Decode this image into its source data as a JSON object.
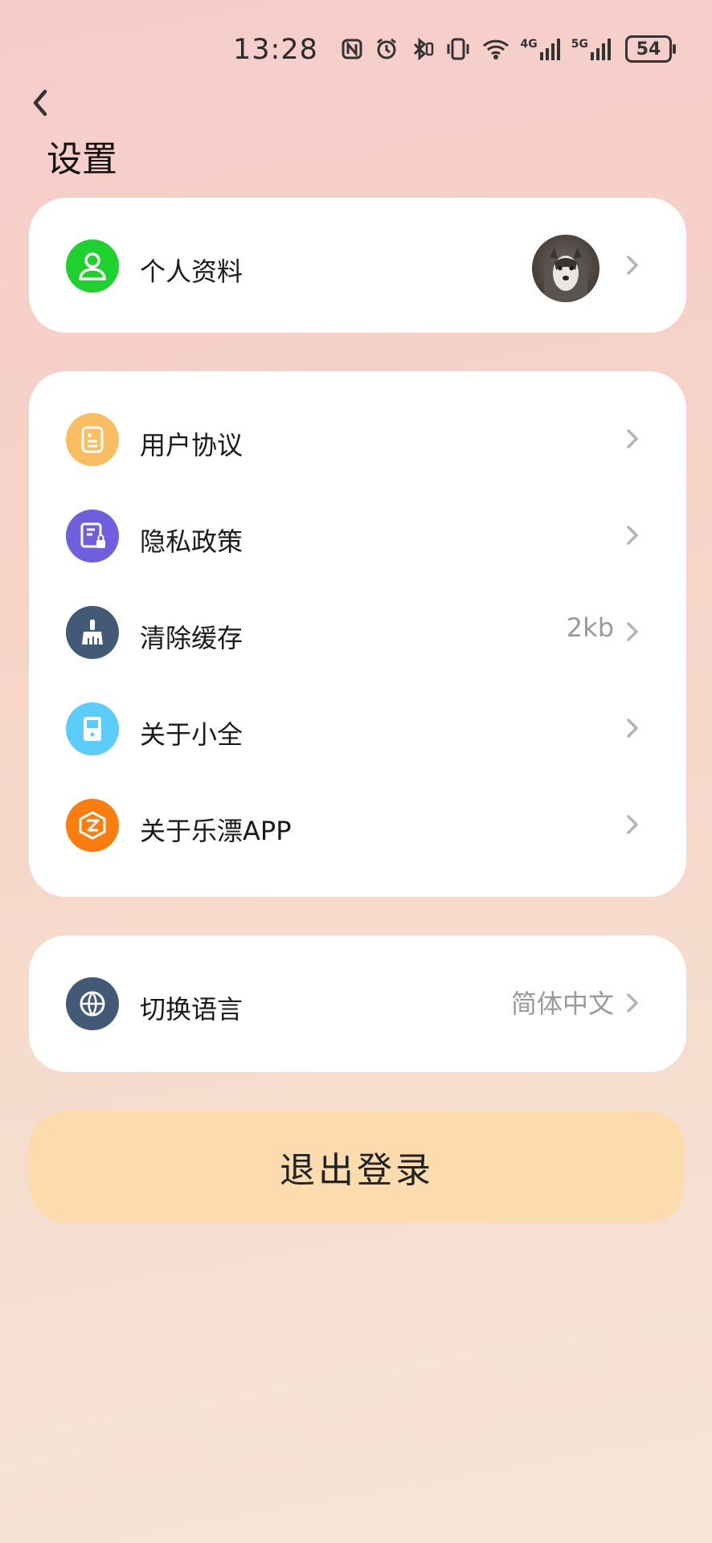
{
  "status_bar": {
    "time": "13:28",
    "battery": "54",
    "icons": [
      "nfc-icon",
      "alarm-icon",
      "bluetooth-icon",
      "vibrate-icon",
      "wifi-icon",
      "signal-4g-icon",
      "signal-5g-icon"
    ],
    "network_4g": "4G",
    "network_5g": "5G"
  },
  "header": {
    "title": "设置",
    "back_icon": "chevron-left-icon"
  },
  "profile": {
    "label": "个人资料",
    "icon": "user-icon",
    "icon_color": "#1fd12e"
  },
  "menu": [
    {
      "key": "user-agreement",
      "label": "用户协议",
      "icon": "document-icon",
      "icon_color": "#fbbd61",
      "value": ""
    },
    {
      "key": "privacy-policy",
      "label": "隐私政策",
      "icon": "privacy-lock-icon",
      "icon_color": "#6f5fdf",
      "value": ""
    },
    {
      "key": "clear-cache",
      "label": "清除缓存",
      "icon": "broom-icon",
      "icon_color": "#435a76",
      "value": "2kb"
    },
    {
      "key": "about-xiaoquan",
      "label": "关于小全",
      "icon": "device-icon",
      "icon_color": "#5ccdfb",
      "value": ""
    },
    {
      "key": "about-app",
      "label": "关于乐漂APP",
      "icon": "app-logo-icon",
      "icon_color": "#fb7c0f",
      "value": ""
    }
  ],
  "language": {
    "label": "切换语言",
    "icon": "globe-icon",
    "icon_color": "#435a76",
    "value": "简体中文"
  },
  "logout": {
    "label": "退出登录",
    "color": "#fcdcae"
  }
}
